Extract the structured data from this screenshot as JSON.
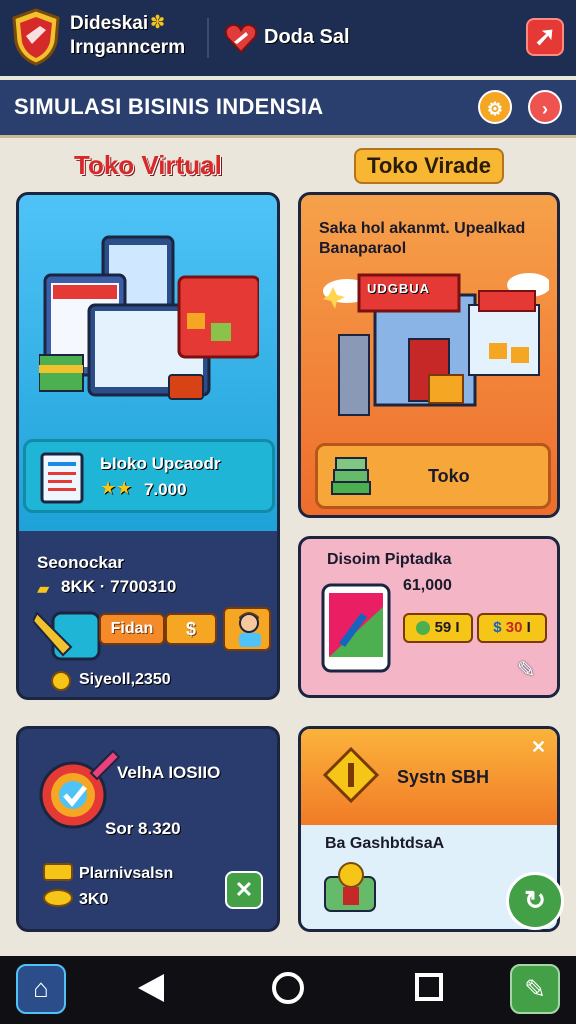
{
  "header": {
    "title_line1": "Dideskai",
    "title_line2": "Irnganncerm",
    "coins_label": "Doda Sal",
    "exit_icon": "exit-icon"
  },
  "titlebar": {
    "app_title": "SIMULASI BISINIS INDENSIA",
    "settings_icon": "gear-icon",
    "close_icon": "close-icon"
  },
  "sections": {
    "left_title": "Toko Virtual",
    "right_title": "Toko Virade"
  },
  "virtual_store": {
    "upgrade_title": "Ыoko Upcaodr",
    "upgrade_value": "7.000",
    "stars": 2,
    "stats_label": "Seonockar",
    "stats_value": "8KK · 7700310",
    "action_button": "Fidan",
    "currency_button": "$",
    "footer_value": "Siyeoll,2350"
  },
  "trade_store": {
    "description": "Saka hol akanmt. Upealkad Banaparaol",
    "sign_text": "UDGBUA",
    "button_label": "Toko"
  },
  "design_card": {
    "title": "Disoim Piptadka",
    "value": "61,000",
    "pill1": "59",
    "pill1_suffix": "I",
    "pill2": "30",
    "pill2_prefix": "$",
    "pill2_suffix": "I",
    "tool_icon": "wrench-icon"
  },
  "target_card": {
    "title": "VelhA IOSIIO",
    "stat": "Sor 8.320",
    "label": "Plarnivsalsn",
    "value": "3K0",
    "confirm_icon": "check-icon"
  },
  "system_card": {
    "title": "Systn SBH",
    "subtitle": "Ba GashbtdsaA",
    "close_icon": "close-icon",
    "fab_icon": "refresh-icon"
  },
  "navbar": {
    "home_icon": "home-icon",
    "back_icon": "back-icon",
    "home_circle_icon": "circle-home-icon",
    "recent_icon": "recent-apps-icon",
    "edit_icon": "pencil-icon"
  },
  "colors": {
    "header_bg": "#1e2e52",
    "titlebar_bg": "#2b3f6e",
    "accent_red": "#e53935",
    "accent_orange": "#f17b27",
    "accent_cyan": "#1fb5d6"
  }
}
